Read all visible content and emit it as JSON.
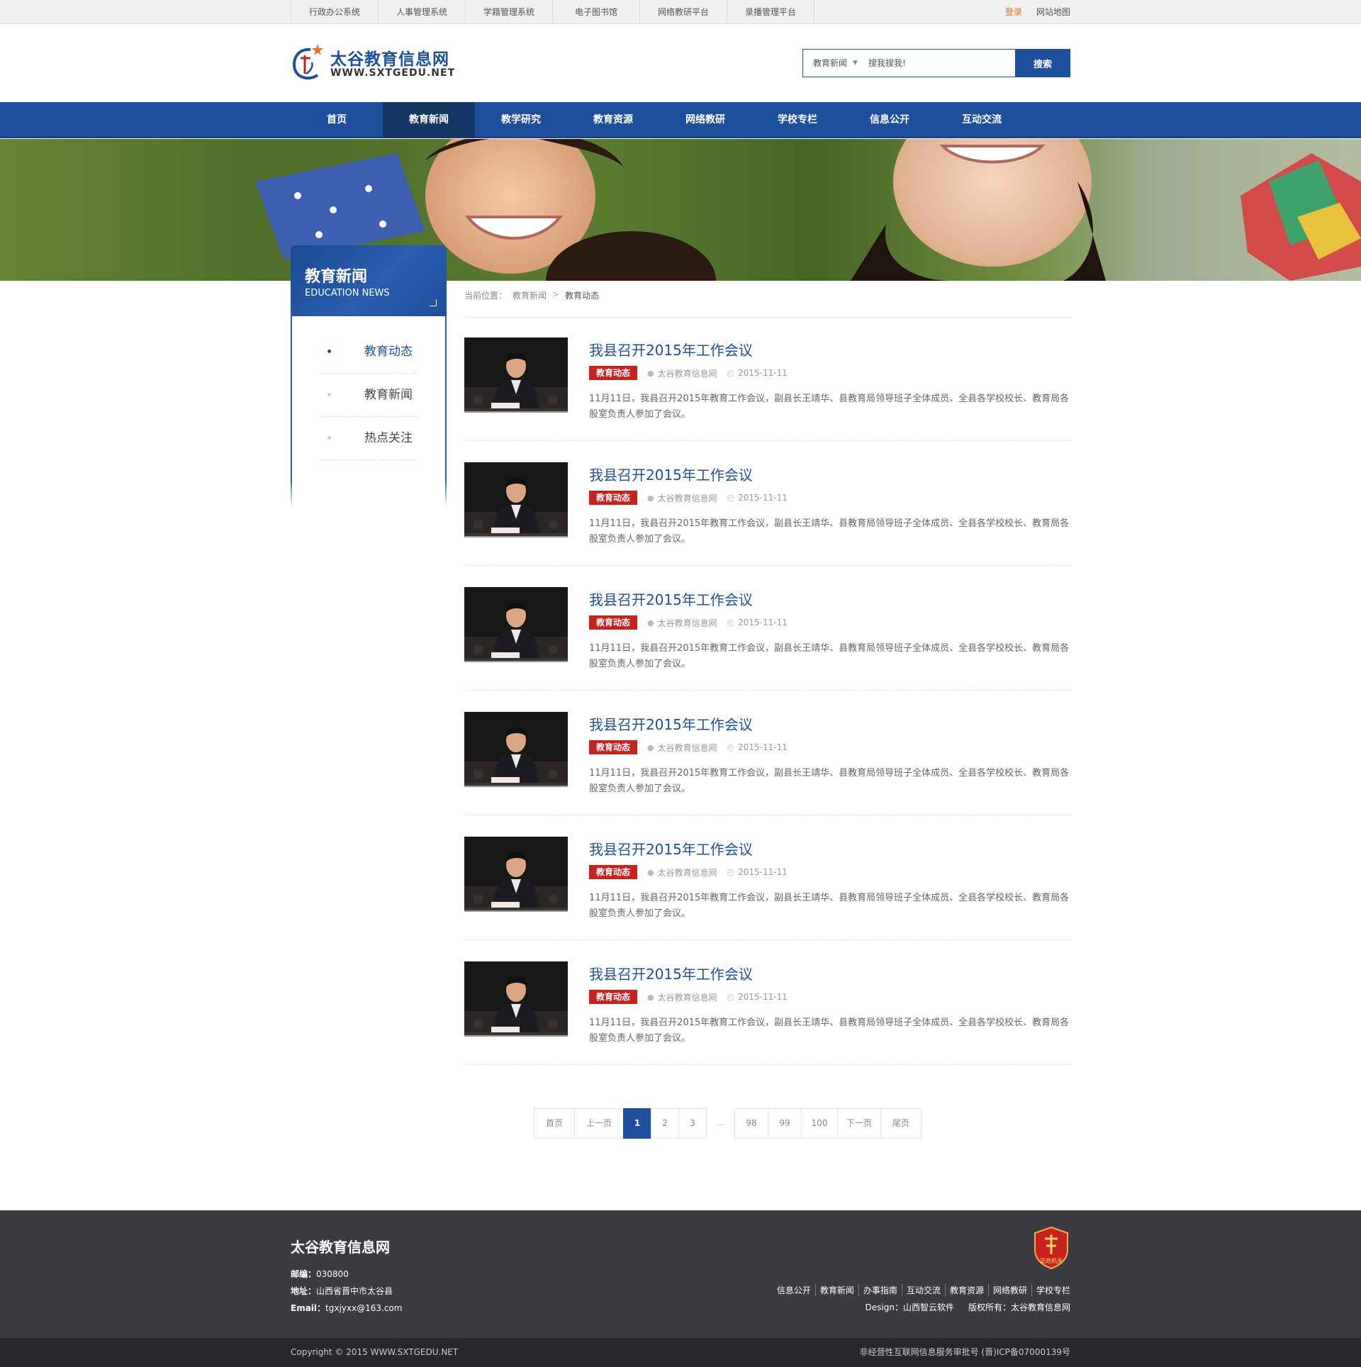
{
  "topbar": {
    "systems": [
      "行政办公系统",
      "人事管理系统",
      "学籍管理系统",
      "电子图书馆",
      "网络教研平台",
      "录播管理平台"
    ],
    "login": "登录",
    "sitemap": "网站地图"
  },
  "header": {
    "logo_cn": "太谷教育信息网",
    "logo_en": "WWW.SXTGEDU.NET",
    "search": {
      "category": "教育新闻",
      "placeholder": "搜我搜我!",
      "button": "搜索"
    }
  },
  "nav": {
    "items": [
      "首页",
      "教育新闻",
      "教学研究",
      "教育资源",
      "网络教研",
      "学校专栏",
      "信息公开",
      "互动交流"
    ],
    "active": "教育新闻"
  },
  "sidebar": {
    "title": "教育新闻",
    "subtitle": "EDUCATION NEWS",
    "items": [
      "教育动态",
      "教育新闻",
      "热点关注"
    ],
    "active": "教育动态"
  },
  "breadcrumb": {
    "label": "当前位置：",
    "parent": "教育新闻",
    "separator": ">",
    "current": "教育动态"
  },
  "news": [
    {
      "title": "我县召开2015年工作会议",
      "tag": "教育动态",
      "source": "太谷教育信息网",
      "date": "2015-11-11",
      "desc": "11月11日，我县召开2015年教育工作会议，副县长王靖华、县教育局领导班子全体成员、全县各学校校长、教育局各股室负责人参加了会议。"
    },
    {
      "title": "我县召开2015年工作会议",
      "tag": "教育动态",
      "source": "太谷教育信息网",
      "date": "2015-11-11",
      "desc": "11月11日，我县召开2015年教育工作会议，副县长王靖华、县教育局领导班子全体成员、全县各学校校长、教育局各股室负责人参加了会议。"
    },
    {
      "title": "我县召开2015年工作会议",
      "tag": "教育动态",
      "source": "太谷教育信息网",
      "date": "2015-11-11",
      "desc": "11月11日，我县召开2015年教育工作会议，副县长王靖华、县教育局领导班子全体成员、全县各学校校长、教育局各股室负责人参加了会议。"
    },
    {
      "title": "我县召开2015年工作会议",
      "tag": "教育动态",
      "source": "太谷教育信息网",
      "date": "2015-11-11",
      "desc": "11月11日，我县召开2015年教育工作会议，副县长王靖华、县教育局领导班子全体成员、全县各学校校长、教育局各股室负责人参加了会议。"
    },
    {
      "title": "我县召开2015年工作会议",
      "tag": "教育动态",
      "source": "太谷教育信息网",
      "date": "2015-11-11",
      "desc": "11月11日，我县召开2015年教育工作会议，副县长王靖华、县教育局领导班子全体成员、全县各学校校长、教育局各股室负责人参加了会议。"
    },
    {
      "title": "我县召开2015年工作会议",
      "tag": "教育动态",
      "source": "太谷教育信息网",
      "date": "2015-11-11",
      "desc": "11月11日，我县召开2015年教育工作会议，副县长王靖华、县教育局领导班子全体成员、全县各学校校长、教育局各股室负责人参加了会议。"
    }
  ],
  "pagination": {
    "first": "首页",
    "prev": "上一页",
    "pages_start": [
      "1",
      "2",
      "3"
    ],
    "ellipsis": "...",
    "pages_end": [
      "98",
      "99",
      "100"
    ],
    "next": "下一页",
    "last": "尾页",
    "current": "1"
  },
  "footer": {
    "title": "太谷教育信息网",
    "postcode_label": "邮编：",
    "postcode": "030800",
    "address_label": "地址：",
    "address": "山西省晋中市太谷县",
    "email_label": "Email：",
    "email": "tgxjyxx@163.com",
    "badge_text": "党政机关",
    "links": [
      "信息公开",
      "教育新闻",
      "办事指南",
      "互动交流",
      "教育资源",
      "网络教研",
      "学校专栏"
    ],
    "design": "Design：山西智云软件",
    "rights": "版权所有：太谷教育信息网",
    "copyright": "Copyright © 2015 WWW.SXTGEDU.NET",
    "icp": "非经营性互联网信息服务审批号 (晋)ICP备07000139号"
  },
  "colors": {
    "brand_blue": "#1e4f9c",
    "nav_active": "#143763",
    "tag_red": "#c9211e",
    "login_orange": "#f06b1e",
    "footer_bg": "#3b3b40"
  }
}
